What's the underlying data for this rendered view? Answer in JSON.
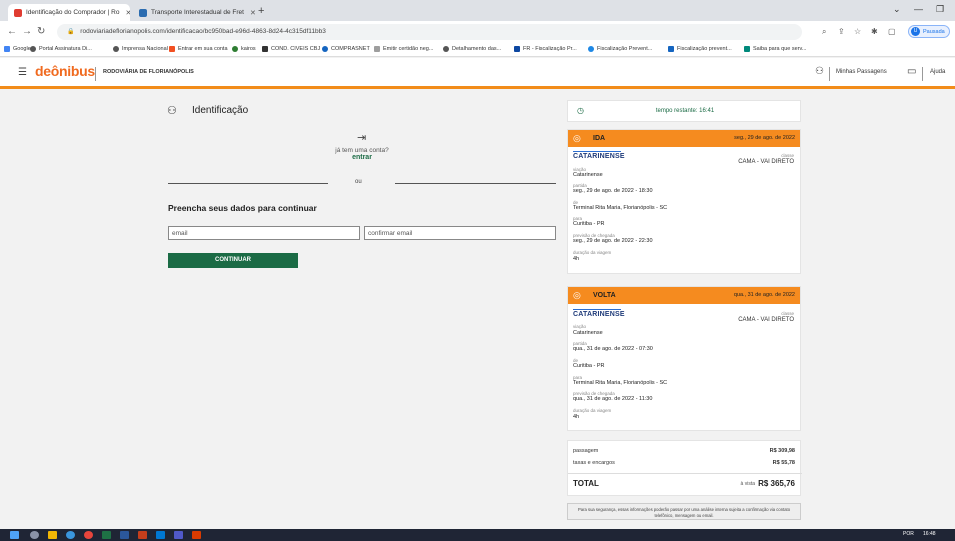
{
  "browser": {
    "tabs": [
      {
        "title": "Identificação do Comprador | Ro",
        "active": true,
        "favicon_color": "#e03c31"
      },
      {
        "title": "Transporte Interestadual de Fret",
        "active": false,
        "favicon_color": "#2b6cb0"
      }
    ],
    "new_tab_icon": "plus-icon",
    "url": "rodoviariadeflorianopolis.com/identificacao/bc950bad-e96d-4863-8d24-4c315df11bb3",
    "profile_status": "Pausada",
    "profile_initial": "U",
    "bookmarks": [
      {
        "label": "Google",
        "color": "#4285f4"
      },
      {
        "label": "Portal Assinatura Di...",
        "color": "#555555"
      },
      {
        "label": "Imprensa Nacional",
        "color": "#555555"
      },
      {
        "label": "Entrar em sua conta",
        "color": "#f25022"
      },
      {
        "label": "kairos",
        "color": "#2e7d32"
      },
      {
        "label": "COND. CIVEIS CBJ",
        "color": "#333333"
      },
      {
        "label": "COMPRASNET",
        "color": "#1565c0"
      },
      {
        "label": "Emitir certidão neg...",
        "color": "#9e9e9e"
      },
      {
        "label": "Detalhamento das...",
        "color": "#555555"
      },
      {
        "label": "FR - Fiscalização Pr...",
        "color": "#0d47a1"
      },
      {
        "label": "Fiscalização Prevent...",
        "color": "#1e88e5"
      },
      {
        "label": "Fiscalização prevent...",
        "color": "#1565c0"
      },
      {
        "label": "Saiba para que serv...",
        "color": "#00897b"
      }
    ]
  },
  "site": {
    "logo": "deônibus",
    "name": "RODOVIÁRIA DE FLORIANÓPOLIS",
    "my_tickets": "Minhas Passagens",
    "help": "Ajuda"
  },
  "form": {
    "title": "Identificação",
    "has_account": "já tem uma conta?",
    "login_link": "entrar",
    "or": "ou",
    "subtitle": "Preencha seus dados para continuar",
    "email_placeholder": "email",
    "confirm_placeholder": "confirmar email",
    "continue_label": "CONTINUAR"
  },
  "timer": {
    "text": "tempo restante: 16:41"
  },
  "trips": [
    {
      "direction": "IDA",
      "date": "seg., 29 de ago. de 2022",
      "company_logo": "CATARINENSE",
      "class_label": "classe",
      "class_value": "CAMA - VAI DIRETO",
      "fields": [
        {
          "label": "viação",
          "value": "Catarinense"
        },
        {
          "label": "partida",
          "value": "seg., 29 de ago. de 2022 - 18:30"
        },
        {
          "label": "de",
          "value": "Terminal Rita Maria, Florianópolis - SC"
        },
        {
          "label": "para",
          "value": "Curitiba - PR"
        },
        {
          "label": "previsão de chegada",
          "value": "seg., 29 de ago. de 2022 - 22:30"
        },
        {
          "label": "duração da viagem",
          "value": "4h"
        }
      ]
    },
    {
      "direction": "VOLTA",
      "date": "qua., 31 de ago. de 2022",
      "company_logo": "CATARINENSE",
      "class_label": "classe",
      "class_value": "CAMA - VAI DIRETO",
      "fields": [
        {
          "label": "viação",
          "value": "Catarinense"
        },
        {
          "label": "partida",
          "value": "qua., 31 de ago. de 2022 - 07:30"
        },
        {
          "label": "de",
          "value": "Curitiba - PR"
        },
        {
          "label": "para",
          "value": "Terminal Rita Maria, Florianópolis - SC"
        },
        {
          "label": "previsão de chegada",
          "value": "qua., 31 de ago. de 2022 - 11:30"
        },
        {
          "label": "duração da viagem",
          "value": "4h"
        }
      ]
    }
  ],
  "totals": {
    "fare_label": "passagem",
    "fare_value": "R$ 309,98",
    "fees_label": "taxas e encargos",
    "fees_value": "R$ 55,78",
    "total_label": "TOTAL",
    "cash_label": "à vista",
    "total_value": "R$ 365,76"
  },
  "security_note": "Para sua segurança, essas informações poderão passar por uma análise interna sujeita a confirmação via contato telefônico, mensagem ou email.",
  "taskbar": {
    "language": "POR",
    "time": "16:48"
  },
  "colors": {
    "brand_orange": "#f58b1f",
    "brand_green": "#1b6b45"
  }
}
